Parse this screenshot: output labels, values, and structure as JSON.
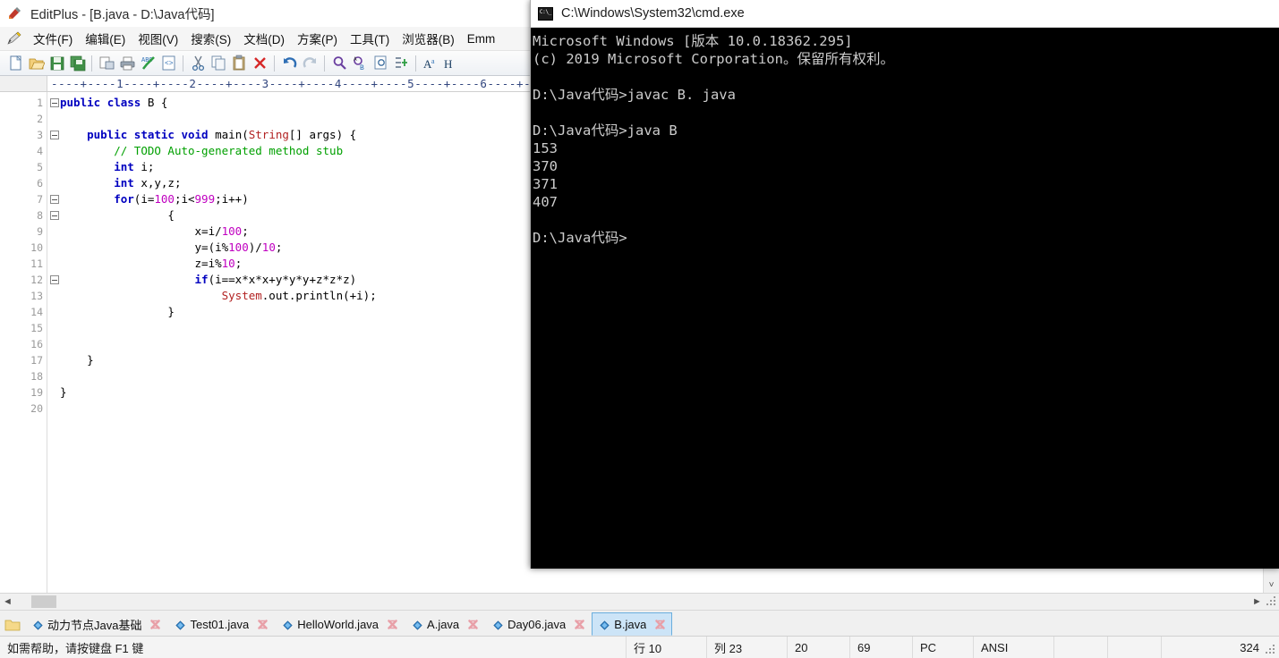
{
  "editplus": {
    "title": "EditPlus - [B.java - D:\\Java代码]",
    "app_icon": "editplus-logo-icon",
    "menu": {
      "pencil_icon": "pencil-icon",
      "items": [
        {
          "label": "文件(F)",
          "name": "menu-file"
        },
        {
          "label": "编辑(E)",
          "name": "menu-edit"
        },
        {
          "label": "视图(V)",
          "name": "menu-view"
        },
        {
          "label": "搜索(S)",
          "name": "menu-search"
        },
        {
          "label": "文档(D)",
          "name": "menu-document"
        },
        {
          "label": "方案(P)",
          "name": "menu-project"
        },
        {
          "label": "工具(T)",
          "name": "menu-tools"
        },
        {
          "label": "浏览器(B)",
          "name": "menu-browser"
        },
        {
          "label": "Emm",
          "name": "menu-emmet"
        }
      ]
    },
    "toolbar": {
      "buttons": [
        {
          "name": "new-file-icon",
          "tip": "新建"
        },
        {
          "name": "open-file-icon",
          "tip": "打开"
        },
        {
          "name": "save-icon",
          "tip": "保存"
        },
        {
          "name": "save-all-icon",
          "tip": "全部保存"
        },
        {
          "name": "sep",
          "tip": ""
        },
        {
          "name": "print-preview-icon",
          "tip": "打印预览"
        },
        {
          "name": "print-icon",
          "tip": "打印"
        },
        {
          "name": "spell-check-icon",
          "tip": "拼写检查"
        },
        {
          "name": "view-source-icon",
          "tip": "查看源代码"
        },
        {
          "name": "sep",
          "tip": ""
        },
        {
          "name": "cut-icon",
          "tip": "剪切"
        },
        {
          "name": "copy-icon",
          "tip": "复制"
        },
        {
          "name": "paste-icon",
          "tip": "粘贴"
        },
        {
          "name": "delete-icon",
          "tip": "删除"
        },
        {
          "name": "sep",
          "tip": ""
        },
        {
          "name": "undo-icon",
          "tip": "撤销"
        },
        {
          "name": "redo-icon",
          "tip": "重做"
        },
        {
          "name": "sep",
          "tip": ""
        },
        {
          "name": "find-icon",
          "tip": "查找"
        },
        {
          "name": "replace-icon",
          "tip": "替换"
        },
        {
          "name": "find-in-files-icon",
          "tip": "在文件中查找"
        },
        {
          "name": "goto-line-icon",
          "tip": "转到行"
        },
        {
          "name": "sep",
          "tip": ""
        },
        {
          "name": "font-icon",
          "tip": "字体"
        },
        {
          "name": "highlight-icon",
          "tip": "高亮"
        }
      ]
    },
    "ruler": "----+----1----+----2----+----3----+----4----+----5----+----6----+--",
    "code": {
      "lines": [
        {
          "no": "1",
          "fold": true,
          "tokens": [
            {
              "t": "public",
              "c": "k"
            },
            {
              "t": " ",
              "c": "p"
            },
            {
              "t": "class",
              "c": "k"
            },
            {
              "t": " B {",
              "c": "p"
            }
          ]
        },
        {
          "no": "2",
          "fold": false,
          "tokens": []
        },
        {
          "no": "3",
          "fold": true,
          "tokens": [
            {
              "t": "    ",
              "c": "p"
            },
            {
              "t": "public",
              "c": "k"
            },
            {
              "t": " ",
              "c": "p"
            },
            {
              "t": "static",
              "c": "k"
            },
            {
              "t": " ",
              "c": "p"
            },
            {
              "t": "void",
              "c": "k"
            },
            {
              "t": " main(",
              "c": "p"
            },
            {
              "t": "String",
              "c": "s"
            },
            {
              "t": "[] args) {",
              "c": "p"
            }
          ]
        },
        {
          "no": "4",
          "fold": false,
          "tokens": [
            {
              "t": "        ",
              "c": "p"
            },
            {
              "t": "// TODO Auto-generated method stub",
              "c": "c"
            }
          ]
        },
        {
          "no": "5",
          "fold": false,
          "tokens": [
            {
              "t": "        ",
              "c": "p"
            },
            {
              "t": "int",
              "c": "k"
            },
            {
              "t": " i;",
              "c": "p"
            }
          ]
        },
        {
          "no": "6",
          "fold": false,
          "tokens": [
            {
              "t": "        ",
              "c": "p"
            },
            {
              "t": "int",
              "c": "k"
            },
            {
              "t": " x,y,z;",
              "c": "p"
            }
          ]
        },
        {
          "no": "7",
          "fold": true,
          "tokens": [
            {
              "t": "        ",
              "c": "p"
            },
            {
              "t": "for",
              "c": "k"
            },
            {
              "t": "(i=",
              "c": "p"
            },
            {
              "t": "100",
              "c": "n"
            },
            {
              "t": ";i<",
              "c": "p"
            },
            {
              "t": "999",
              "c": "n"
            },
            {
              "t": ";i++)",
              "c": "p"
            }
          ]
        },
        {
          "no": "8",
          "fold": true,
          "tokens": [
            {
              "t": "                {",
              "c": "p"
            }
          ]
        },
        {
          "no": "9",
          "fold": false,
          "tokens": [
            {
              "t": "                    x=i/",
              "c": "p"
            },
            {
              "t": "100",
              "c": "n"
            },
            {
              "t": ";",
              "c": "p"
            }
          ]
        },
        {
          "no": "10",
          "fold": false,
          "tokens": [
            {
              "t": "                    y=(i%",
              "c": "p"
            },
            {
              "t": "100",
              "c": "n"
            },
            {
              "t": ")/",
              "c": "p"
            },
            {
              "t": "10",
              "c": "n"
            },
            {
              "t": ";",
              "c": "p"
            }
          ]
        },
        {
          "no": "11",
          "fold": false,
          "tokens": [
            {
              "t": "                    z=i%",
              "c": "p"
            },
            {
              "t": "10",
              "c": "n"
            },
            {
              "t": ";",
              "c": "p"
            }
          ]
        },
        {
          "no": "12",
          "fold": true,
          "tokens": [
            {
              "t": "                    ",
              "c": "p"
            },
            {
              "t": "if",
              "c": "k"
            },
            {
              "t": "(i==x*x*x+y*y*y+z*z*z)",
              "c": "p"
            }
          ]
        },
        {
          "no": "13",
          "fold": false,
          "tokens": [
            {
              "t": "                        ",
              "c": "p"
            },
            {
              "t": "System",
              "c": "s"
            },
            {
              "t": ".out.println(+i);",
              "c": "p"
            }
          ]
        },
        {
          "no": "14",
          "fold": false,
          "tokens": [
            {
              "t": "                }",
              "c": "p"
            }
          ]
        },
        {
          "no": "15",
          "fold": false,
          "tokens": []
        },
        {
          "no": "16",
          "fold": false,
          "tokens": []
        },
        {
          "no": "17",
          "fold": false,
          "tokens": [
            {
              "t": "    }",
              "c": "p"
            }
          ]
        },
        {
          "no": "18",
          "fold": false,
          "tokens": []
        },
        {
          "no": "19",
          "fold": false,
          "tokens": [
            {
              "t": "}",
              "c": "p"
            }
          ]
        },
        {
          "no": "20",
          "fold": false,
          "tokens": []
        }
      ]
    },
    "tabs": {
      "folder_icon": "folder-icon",
      "items": [
        {
          "label": "动力节点Java基础",
          "active": false,
          "name": "tab-dongli-java-jichu"
        },
        {
          "label": "Test01.java",
          "active": false,
          "name": "tab-test01-java"
        },
        {
          "label": "HelloWorld.java",
          "active": false,
          "name": "tab-helloworld-java"
        },
        {
          "label": "A.java",
          "active": false,
          "name": "tab-a-java"
        },
        {
          "label": "Day06.java",
          "active": false,
          "name": "tab-day06-java"
        },
        {
          "label": "B.java",
          "active": true,
          "name": "tab-b-java"
        }
      ]
    },
    "statusbar": {
      "help": "如需帮助，请按键盘 F1 键",
      "line": "行 10",
      "col": "列 23",
      "value1": "20",
      "value2": "69",
      "platform": "PC",
      "encoding": "ANSI",
      "total": "324"
    },
    "scroll": {
      "left_arrow": "◄",
      "right_arrow": "►",
      "down_arrow": "˅"
    }
  },
  "cmd": {
    "title": "C:\\Windows\\System32\\cmd.exe",
    "icon": "cmd-console-icon",
    "lines": [
      "Microsoft Windows [版本 10.0.18362.295]",
      "(c) 2019 Microsoft Corporation。保留所有权利。",
      "",
      "D:\\Java代码>javac B. java",
      "",
      "D:\\Java代码>java B",
      "153",
      "370",
      "371",
      "407",
      "",
      "D:\\Java代码>"
    ]
  },
  "colors": {
    "keyword": "#0000c0",
    "number": "#c000c0",
    "comment": "#00a000",
    "classname": "#b22222",
    "active_tab_bg": "#cce4f7",
    "console_bg": "#000000",
    "console_fg": "#cccccc"
  }
}
